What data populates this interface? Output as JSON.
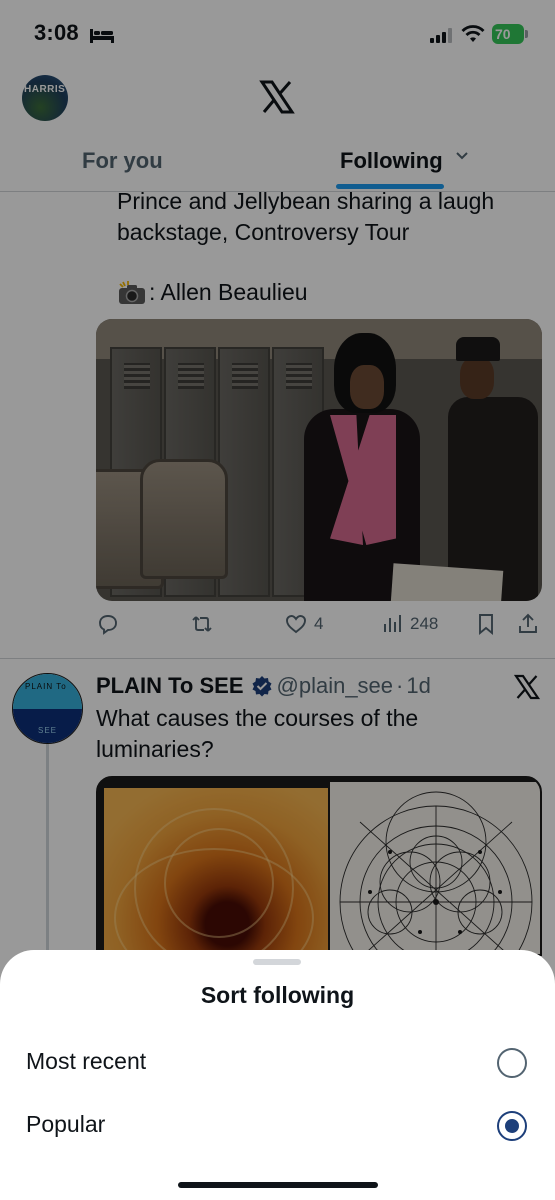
{
  "status_bar": {
    "time": "3:08",
    "battery": "70",
    "battery_color": "#34c759"
  },
  "header": {
    "avatar_text": "HARRIS",
    "tabs": [
      {
        "label": "For you",
        "active": false
      },
      {
        "label": "Following",
        "active": true
      }
    ],
    "accent_color": "#1d9bf0"
  },
  "tweets": [
    {
      "text": "Prince and Jellybean sharing a laugh backstage, Controversy Tour",
      "credit": ": Allen Beaulieu",
      "credit_icon": "camera-flash-emoji",
      "actions": {
        "replies": "",
        "reposts": "",
        "likes": "4",
        "views": "248"
      }
    },
    {
      "name": "PLAIN To SEE",
      "handle": "@plain_see",
      "separator": "·",
      "time": "1d",
      "text": "What causes the courses of the luminaries?",
      "avatar_text_top": "PLAIN To",
      "avatar_text_bottom": "SEE"
    }
  ],
  "sheet": {
    "title": "Sort following",
    "options": [
      {
        "label": "Most recent",
        "selected": false
      },
      {
        "label": "Popular",
        "selected": true
      }
    ],
    "selected_color": "#1d3f7a"
  }
}
